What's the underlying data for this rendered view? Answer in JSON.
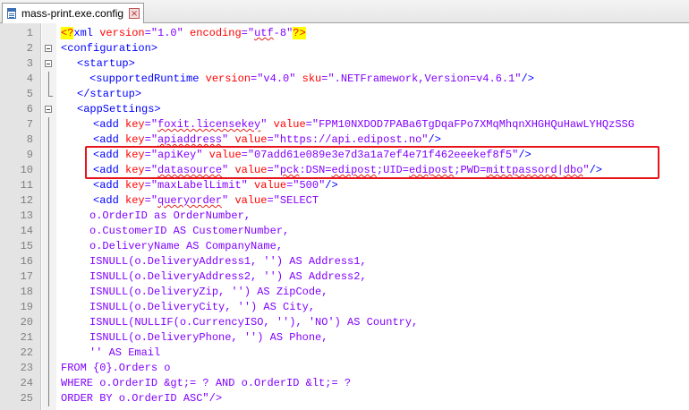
{
  "tab": {
    "title": "mass-print.exe.config",
    "close_glyph": "×"
  },
  "editor": {
    "line_numbers": [
      "1",
      "2",
      "3",
      "4",
      "5",
      "6",
      "7",
      "8",
      "9",
      "10",
      "11",
      "12",
      "13",
      "14",
      "15",
      "16",
      "17",
      "18",
      "19",
      "20",
      "21",
      "22",
      "23",
      "24",
      "25"
    ],
    "lines": {
      "l1": {
        "pi_open": "<?",
        "name": "xml",
        "a1": " version",
        "eq1": "=",
        "v1": "\"1.0\"",
        "a2": " encoding",
        "eq2": "=",
        "v2q1": "\"",
        "v2": "utf",
        "v2q2": "-8\"",
        "pi_close": "?>"
      },
      "l2": {
        "open": "<",
        "name": "configuration",
        "close": ">"
      },
      "l3": {
        "open": "<",
        "name": "startup",
        "close": ">"
      },
      "l4": {
        "open": "<",
        "name": "supportedRuntime",
        "a1": " version",
        "eq1": "=",
        "v1": "\"v4.0\"",
        "a2": " sku",
        "eq2": "=",
        "v2": "\".NETFramework,Version=v4.6.1\"",
        "close": "/>"
      },
      "l5": {
        "open": "</",
        "name": "startup",
        "close": ">"
      },
      "l6": {
        "open": "<",
        "name": "appSettings",
        "close": ">"
      },
      "l7": {
        "open": "<",
        "name": "add",
        "a1": " key",
        "eq1": "=",
        "q1a": "\"",
        "k1": "foxit.licensekey",
        "q1b": "\"",
        "a2": " value",
        "eq2": "=",
        "v2": "\"FPM10NXDOD7PABa6TgDqaFPo7XMqMhqnXHGHQuHawLYHQzSSG"
      },
      "l8": {
        "open": "<",
        "name": "add",
        "a1": " key",
        "eq1": "=",
        "q1a": "\"",
        "k1": "apiaddress",
        "q1b": "\"",
        "a2": " value",
        "eq2": "=",
        "v2": "\"https://api.edipost.no\"",
        "close": "/>"
      },
      "l9": {
        "open": "<",
        "name": "add",
        "a1": " key",
        "eq1": "=",
        "v1": "\"apiKey\"",
        "a2": " value",
        "eq2": "=",
        "v2": "\"07add61e089e3e7d3a1a7ef4e71f462eeekef8f5\"",
        "close": "/>"
      },
      "l10": {
        "open": "<",
        "name": "add",
        "a1": " key",
        "eq1": "=",
        "q1a": "\"",
        "k1": "datasource",
        "q1b": "\"",
        "a2": " value",
        "eq2": "=",
        "v2a": "\"",
        "v2b": "pck",
        "v2c": ":DSN=",
        "v2d": "edipost",
        "v2e": ";UID=",
        "v2f": "edipost",
        "v2g": ";PWD=",
        "v2h": "mittpassord",
        "v2i": "|",
        "v2j": "dbo",
        "v2k": "\"",
        "close": "/>"
      },
      "l11": {
        "open": "<",
        "name": "add",
        "a1": " key",
        "eq1": "=",
        "q1a": "\"",
        "k1": "maxLabelLimit",
        "q1b": "\"",
        "a2": " value",
        "eq2": "=",
        "v2": "\"500\"",
        "close": "/>"
      },
      "l12": {
        "open": "<",
        "name": "add",
        "a1": " key",
        "eq1": "=",
        "q1a": "\"",
        "k1": "queryorder",
        "q1b": "\"",
        "a2": " value",
        "eq2": "=",
        "v2": "\"SELECT"
      },
      "l13": {
        "text": "o.OrderID as OrderNumber,"
      },
      "l14": {
        "text": "o.CustomerID AS CustomerNumber,"
      },
      "l15": {
        "text": "o.DeliveryName AS CompanyName,"
      },
      "l16": {
        "text": "ISNULL(o.DeliveryAddress1, '') AS Address1,"
      },
      "l17": {
        "text": "ISNULL(o.DeliveryAddress2, '') AS Address2,"
      },
      "l18": {
        "text": "ISNULL(o.DeliveryZip, '') AS ZipCode,"
      },
      "l19": {
        "text": "ISNULL(o.DeliveryCity, '') AS City,"
      },
      "l20": {
        "text": "ISNULL(NULLIF(o.CurrencyISO, ''), 'NO') AS Country,"
      },
      "l21": {
        "text": "ISNULL(o.DeliveryPhone, '') AS Phone,"
      },
      "l22": {
        "text": "'' AS Email"
      },
      "l23": {
        "text": "FROM {0}.Orders o"
      },
      "l24": {
        "text": "WHERE o.OrderID &gt;= ? AND o.OrderID &lt;= ?"
      },
      "l25": {
        "text": "ORDER BY o.OrderID ASC\"/>"
      }
    }
  },
  "colors": {
    "tag": "#0000ff",
    "attribute": "#ff0000",
    "value": "#8000ff",
    "highlight_box": "#e8141b",
    "pi_background": "#ffff00"
  }
}
